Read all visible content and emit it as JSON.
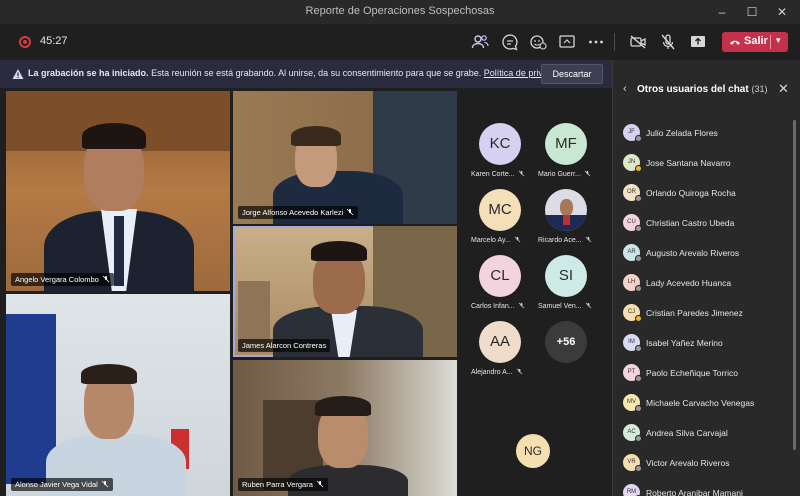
{
  "window": {
    "title": "Reporte de Operaciones Sospechosas"
  },
  "toolbar": {
    "timer": "45:27",
    "leave_label": "Salir"
  },
  "banner": {
    "bold": "La grabación se ha iniciado.",
    "text": "Esta reunión se está grabando. Al unirse, da su consentimiento para que se grabe.",
    "link": "Política de privacidad",
    "dismiss": "Descartar"
  },
  "video_tiles": [
    {
      "name": "Angelo Vergara Colombo"
    },
    {
      "name": "Jorge Alfonso Acevedo Karlezi"
    },
    {
      "name": "James Alarcon Contreras"
    },
    {
      "name": "Alonso Javier Vega Vidal"
    },
    {
      "name": "Ruben Parra Vergara"
    }
  ],
  "avatar_grid": [
    {
      "initials": "KC",
      "name": "Karen Corte...",
      "color": "#d6d1f0"
    },
    {
      "initials": "MF",
      "name": "Mario Guerr...",
      "color": "#c9e8d4"
    },
    {
      "initials": "MC",
      "name": "Marcelo Ay...",
      "color": "#f5dfb8"
    },
    {
      "initials": "",
      "name": "Ricardo Ace...",
      "color": "#ffffff"
    },
    {
      "initials": "CL",
      "name": "Carlos Infan...",
      "color": "#f3d3de"
    },
    {
      "initials": "SI",
      "name": "Samuel Ven...",
      "color": "#cdeae6"
    },
    {
      "initials": "AA",
      "name": "Alejandro A...",
      "color": "#f0dccb"
    }
  ],
  "more_count": "+56",
  "extra_avatar": {
    "initials": "NG",
    "color": "#f5dfb0"
  },
  "sidebar": {
    "title": "Otros usuarios del chat",
    "count": "(31)",
    "people": [
      {
        "initials": "JF",
        "name": "Julio Zelada Flores",
        "color": "#d6d1f0",
        "status": "#9a9a9a"
      },
      {
        "initials": "JN",
        "name": "Jose Santana Navarro",
        "color": "#dde8c9",
        "status": "#f1b72c"
      },
      {
        "initials": "OR",
        "name": "Orlando Quiroga Rocha",
        "color": "#f5e1c4",
        "status": "#9a9a9a"
      },
      {
        "initials": "CU",
        "name": "Christian Castro Ubeda",
        "color": "#f3d3de",
        "status": "#9a9a9a"
      },
      {
        "initials": "AR",
        "name": "Augusto Arevalo Riveros",
        "color": "#cde5ea",
        "status": "#9a9a9a"
      },
      {
        "initials": "LH",
        "name": "Lady Acevedo Huanca",
        "color": "#f6d1c9",
        "status": "#9a9a9a"
      },
      {
        "initials": "CJ",
        "name": "Cristian Paredes Jimenez",
        "color": "#f5dfb0",
        "status": "#f1b72c"
      },
      {
        "initials": "IM",
        "name": "Isabel Yañez Merino",
        "color": "#d7dcf0",
        "status": "#9a9a9a"
      },
      {
        "initials": "PT",
        "name": "Paolo Echeñique Torrico",
        "color": "#f3d3de",
        "status": "#9a9a9a"
      },
      {
        "initials": "MV",
        "name": "Michaele Carvacho Venegas",
        "color": "#f5e9b0",
        "status": "#9a9a9a"
      },
      {
        "initials": "AC",
        "name": "Andrea Silva Carvajal",
        "color": "#d1ecd9",
        "status": "#9a9a9a"
      },
      {
        "initials": "VR",
        "name": "Victor Arevalo Riveros",
        "color": "#f5dfb0",
        "status": "#9a9a9a"
      },
      {
        "initials": "RM",
        "name": "Roberto Aranibar Mamani",
        "color": "#e3d6f0",
        "status": "#9a9a9a"
      }
    ]
  }
}
